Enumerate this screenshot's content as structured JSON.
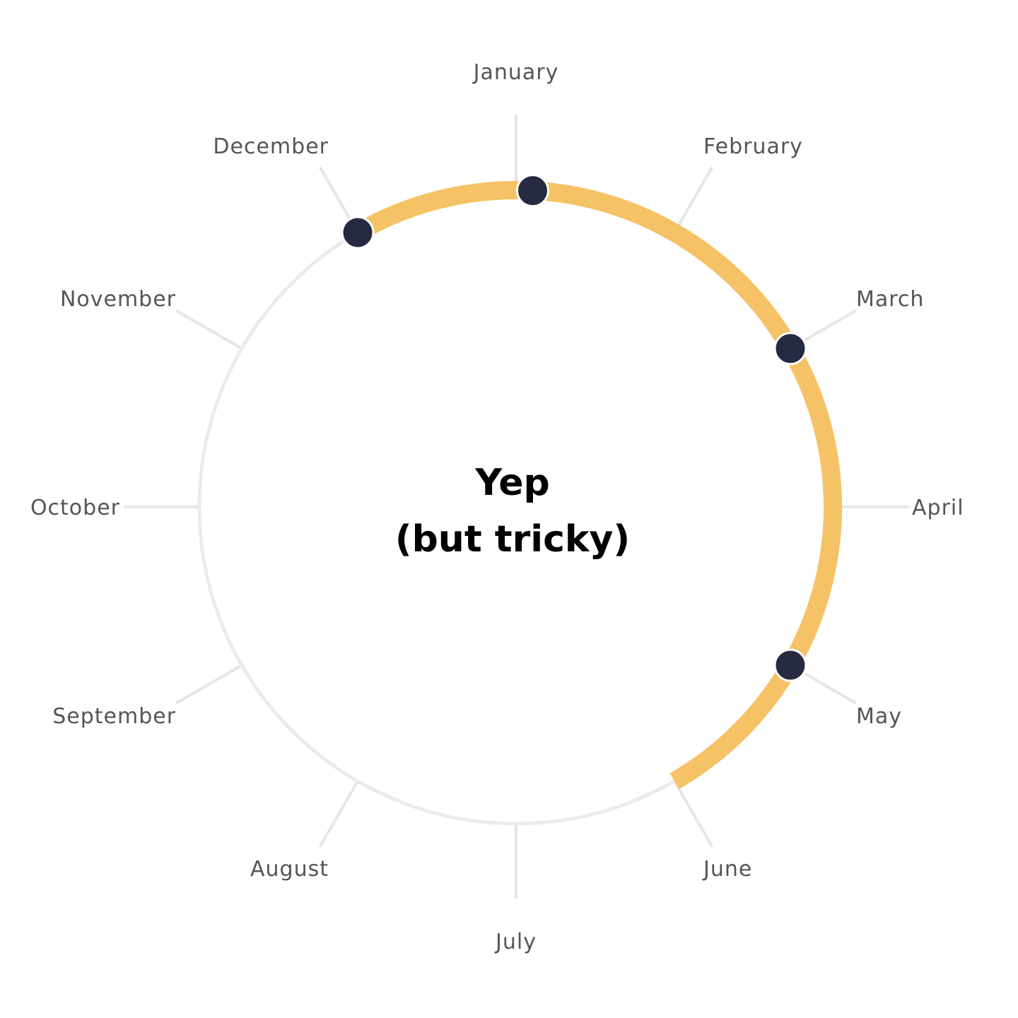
{
  "center_text": {
    "line1": "Yep",
    "line2": "(but tricky)"
  },
  "months": [
    "January",
    "February",
    "March",
    "April",
    "May",
    "June",
    "July",
    "August",
    "September",
    "October",
    "November",
    "December"
  ],
  "highlight": {
    "start_month": "December",
    "end_month": "June",
    "color": "#F6C266"
  },
  "markers": [
    "December",
    "January",
    "March",
    "May"
  ],
  "colors": {
    "ring": "#EBEBEB",
    "tick": "#E6E6E6",
    "label": "#555555",
    "marker": "#262A40",
    "center_text": "#000000"
  }
}
